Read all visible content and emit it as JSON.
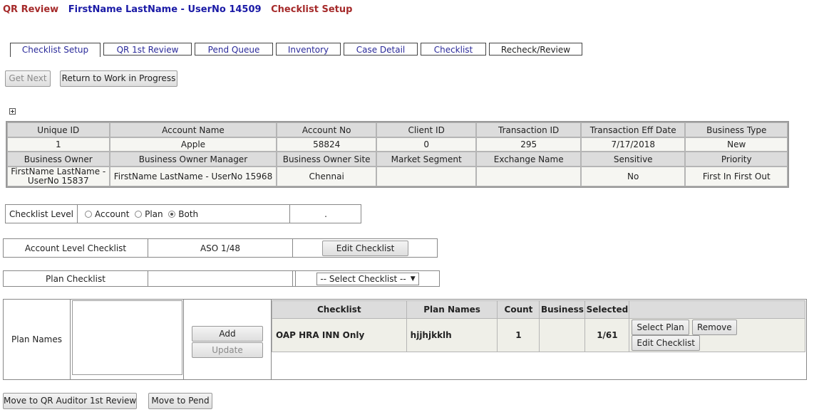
{
  "header": {
    "module": "QR Review",
    "user": "FirstName LastName - UserNo 14509",
    "page": "Checklist Setup"
  },
  "tabs": [
    {
      "label": "Checklist Setup"
    },
    {
      "label": "QR 1st Review"
    },
    {
      "label": "Pend Queue"
    },
    {
      "label": "Inventory"
    },
    {
      "label": "Case Detail"
    },
    {
      "label": "Checklist"
    },
    {
      "label": "Recheck/Review"
    }
  ],
  "actions": {
    "get_next": "Get Next",
    "return_wip": "Return to Work in Progress"
  },
  "expand_icon": "plus-box-icon",
  "info": {
    "headers1": [
      "Unique ID",
      "Account Name",
      "Account No",
      "Client ID",
      "Transaction ID",
      "Transaction Eff Date",
      "Business Type"
    ],
    "values1": [
      "1",
      "Apple",
      "58824",
      "0",
      "295",
      "7/17/2018",
      "New"
    ],
    "headers2": [
      "Business Owner",
      "Business Owner Manager",
      "Business Owner Site",
      "Market Segment",
      "Exchange Name",
      "Sensitive",
      "Priority"
    ],
    "values2": [
      "FirstName LastName - UserNo 15837",
      "FirstName LastName - UserNo 15968",
      "Chennai",
      "",
      "",
      "No",
      "First In First Out"
    ]
  },
  "checklist_level": {
    "label": "Checklist Level",
    "options": [
      "Account",
      "Plan",
      "Both"
    ],
    "selected": "Both",
    "extra": "."
  },
  "account_checklist": {
    "label": "Account Level Checklist",
    "value": "ASO 1/48",
    "button": "Edit Checklist"
  },
  "plan_checklist": {
    "label": "Plan Checklist",
    "value": "",
    "select_value": "-- Select Checklist --"
  },
  "plan_names": {
    "label": "Plan Names",
    "textarea_value": "",
    "add": "Add",
    "update": "Update"
  },
  "plan_table": {
    "columns": [
      "Checklist",
      "Plan Names",
      "Count",
      "Business",
      "Selected",
      ""
    ],
    "rows": [
      {
        "checklist": "OAP HRA INN Only",
        "plan_names": "hjjhjkklh",
        "count": "1",
        "business": "",
        "selected": "1/61",
        "select_plan": "Select Plan",
        "remove": "Remove",
        "edit": "Edit Checklist"
      }
    ]
  },
  "footer": {
    "move_qr": "Move to QR Auditor 1st Review",
    "move_pend": "Move to Pend"
  }
}
